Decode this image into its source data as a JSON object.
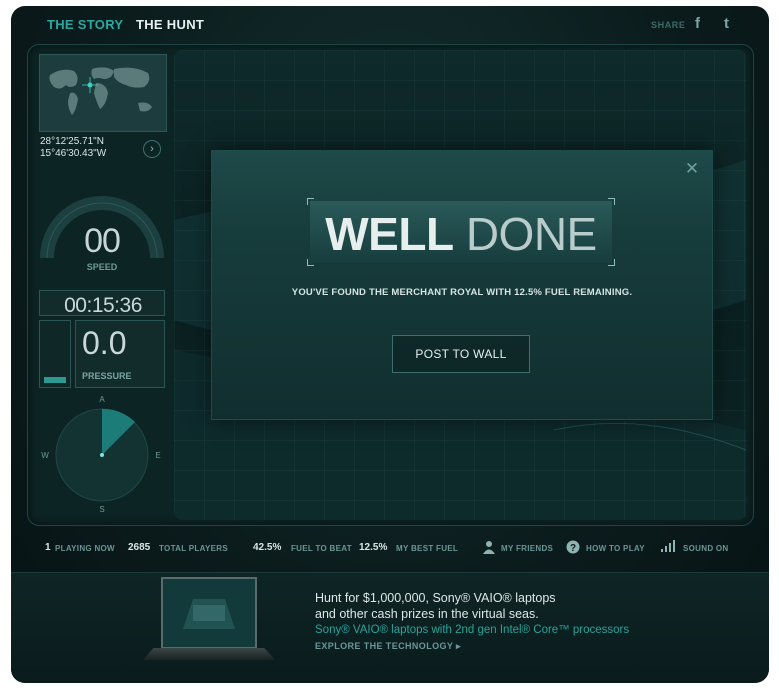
{
  "nav": {
    "story": "THE STORY",
    "hunt": "THE HUNT"
  },
  "share": {
    "label": "SHARE",
    "facebook_glyph": "f",
    "twitter_glyph": "t"
  },
  "hud": {
    "lat": "28°12'25.71\"N",
    "lon": "15°46'30.43\"W",
    "speed": "00",
    "speed_label": "SPEED",
    "timer": "00:15:36",
    "pressure": "0.0",
    "pressure_label": "PRESSURE",
    "fuel_level_fraction": 0.1,
    "compass": {
      "n": "A",
      "w": "W",
      "e": "E",
      "s": "S"
    }
  },
  "dialog": {
    "title_bold": "WELL",
    "title_light": "DONE",
    "message": "YOU'VE FOUND THE MERCHANT ROYAL WITH 12.5% FUEL REMAINING.",
    "button": "POST TO WALL"
  },
  "status": {
    "playing_now": "1",
    "playing_now_label": "PLAYING NOW",
    "total_players": "2685",
    "total_players_label": "TOTAL PLAYERS",
    "fuel_to_beat": "42.5%",
    "fuel_to_beat_label": "FUEL TO BEAT",
    "best_fuel": "12.5%",
    "best_fuel_label": "MY BEST FUEL",
    "my_friends": "MY FRIENDS",
    "how_to_play": "HOW TO PLAY",
    "sound_on": "SOUND ON"
  },
  "ad": {
    "line1": "Hunt for $1,000,000, Sony® VAIO® laptops",
    "line2": "and other cash prizes in the virtual seas.",
    "line3": "Sony® VAIO® laptops with 2nd gen Intel® Core™ processors",
    "link": "EXPLORE THE TECHNOLOGY ▸"
  },
  "colors": {
    "accent": "#2aa8a0",
    "background": "#0b1b1c",
    "text": "#e8f2f2"
  }
}
